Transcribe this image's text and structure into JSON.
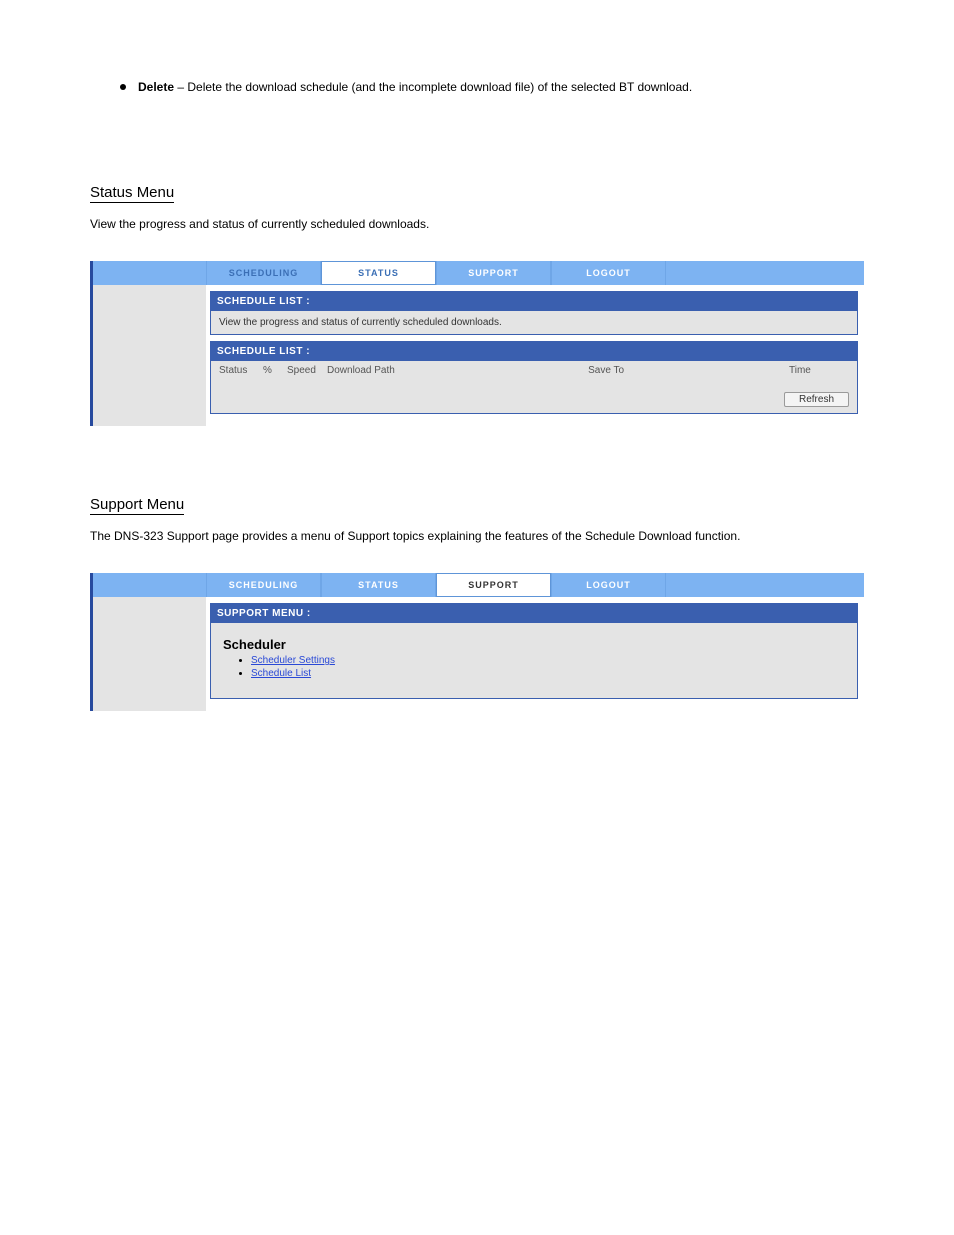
{
  "top_bullet": {
    "label": "Delete",
    "desc": "Delete the download schedule (and the incomplete download file) of the selected BT download."
  },
  "section_status": {
    "heading": "Status Menu",
    "desc": "View the progress and status of currently scheduled downloads.",
    "tabs": {
      "scheduling": "SCHEDULING",
      "status": "STATUS",
      "support": "SUPPORT",
      "logout": "LOGOUT"
    },
    "panel1_title": "SCHEDULE LIST :",
    "panel1_text": "View the progress and status of currently scheduled downloads.",
    "panel2_title": "SCHEDULE LIST :",
    "cols": {
      "status": "Status",
      "pct": "%",
      "speed": "Speed",
      "path": "Download Path",
      "save": "Save To",
      "time": "Time"
    },
    "refresh": "Refresh"
  },
  "section_support": {
    "heading": "Support Menu",
    "desc": "The DNS-323 Support page provides a menu of Support topics explaining the features of the Schedule Download function.",
    "tabs": {
      "scheduling": "SCHEDULING",
      "status": "STATUS",
      "support": "SUPPORT",
      "logout": "LOGOUT"
    },
    "panel_title": "SUPPORT MENU :",
    "group_title": "Scheduler",
    "links": {
      "settings": "Scheduler Settings",
      "list": "Schedule List"
    }
  }
}
